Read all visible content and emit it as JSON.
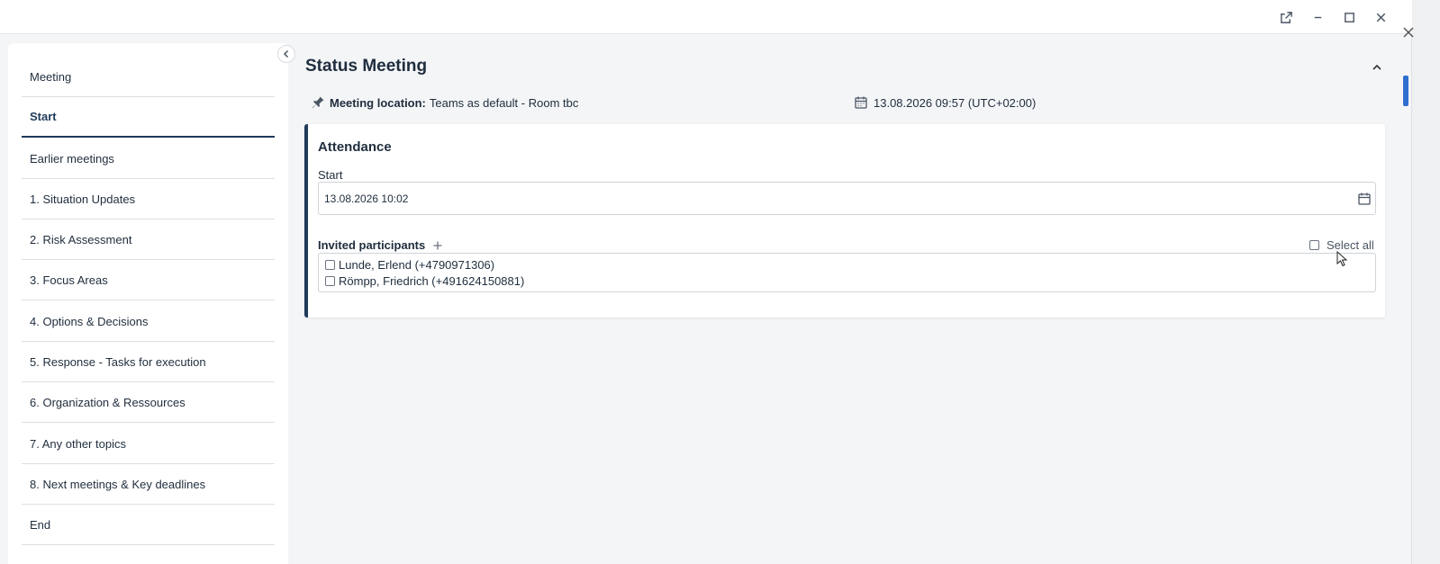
{
  "window": {
    "controls": [
      "popout-icon",
      "minimize-icon",
      "maximize-icon",
      "close-icon"
    ]
  },
  "sidebar": {
    "items": [
      {
        "label": "Meeting",
        "active": false
      },
      {
        "label": "Start",
        "active": true
      },
      {
        "label": "Earlier meetings",
        "active": false
      },
      {
        "label": "1. Situation Updates",
        "active": false
      },
      {
        "label": "2. Risk Assessment",
        "active": false
      },
      {
        "label": "3. Focus Areas",
        "active": false
      },
      {
        "label": "4. Options & Decisions",
        "active": false
      },
      {
        "label": "5. Response - Tasks for execution",
        "active": false
      },
      {
        "label": "6. Organization & Ressources",
        "active": false
      },
      {
        "label": "7. Any other topics",
        "active": false
      },
      {
        "label": "8. Next meetings & Key deadlines",
        "active": false
      },
      {
        "label": "End",
        "active": false
      }
    ]
  },
  "main": {
    "title": "Status Meeting",
    "location_label": "Meeting location:",
    "location_value": "Teams as default - Room tbc",
    "datetime": "13.08.2026 09:57 (UTC+02:00)",
    "attendance": {
      "title": "Attendance",
      "start_label": "Start",
      "start_value": "13.08.2026 10:02",
      "participants_label": "Invited participants",
      "select_all_label": "Select all",
      "participants": [
        {
          "name": "Lunde, Erlend (+4790971306)",
          "checked": false
        },
        {
          "name": "Römpp, Friedrich (+491624150881)",
          "checked": false
        }
      ]
    }
  },
  "colors": {
    "accent": "#1f3a5a",
    "text": "#1f2d3d",
    "border": "#cfd3d8",
    "background": "#f4f5f7"
  }
}
